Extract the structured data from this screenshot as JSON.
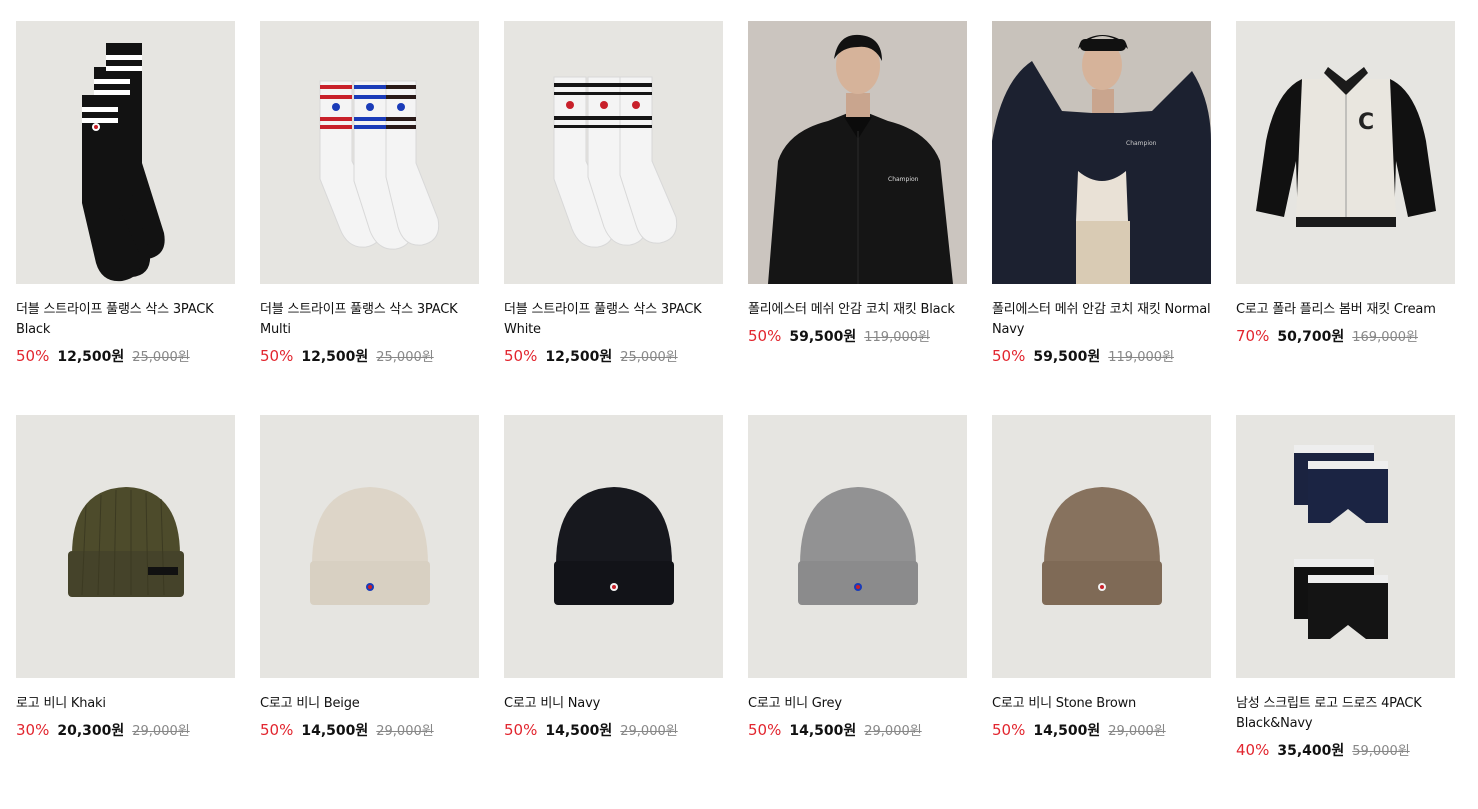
{
  "products": [
    {
      "name": "더블 스트라이프 풀랭스 삭스 3PACK Black",
      "discount": "50%",
      "price": "12,500원",
      "original": "25,000원",
      "image": "black-socks-3pack",
      "stripe_color": "#111111"
    },
    {
      "name": "더블 스트라이프 풀랭스 삭스 3PACK Multi",
      "discount": "50%",
      "price": "12,500원",
      "original": "25,000원",
      "image": "multi-socks-3pack"
    },
    {
      "name": "더블 스트라이프 풀랭스 삭스 3PACK White",
      "discount": "50%",
      "price": "12,500원",
      "original": "25,000원",
      "image": "white-socks-3pack"
    },
    {
      "name": "폴리에스터 메쉬 안감 코치 재킷 Black",
      "discount": "50%",
      "price": "59,500원",
      "original": "119,000원",
      "image": "black-coach-jacket-male-model"
    },
    {
      "name": "폴리에스터 메쉬 안감 코치 재킷 Normal Navy",
      "discount": "50%",
      "price": "59,500원",
      "original": "119,000원",
      "image": "navy-coach-jacket-female-model"
    },
    {
      "name": "C로고 폴라 플리스 봄버 재킷 Cream",
      "discount": "70%",
      "price": "50,700원",
      "original": "169,000원",
      "image": "cream-fleece-bomber"
    },
    {
      "name": "로고 비니 Khaki",
      "discount": "30%",
      "price": "20,300원",
      "original": "29,000원",
      "image": "khaki-beanie",
      "color": "#4b4a2a"
    },
    {
      "name": "C로고 비니 Beige",
      "discount": "50%",
      "price": "14,500원",
      "original": "29,000원",
      "image": "beige-beanie",
      "color": "#ddd5c8"
    },
    {
      "name": "C로고 비니 Navy",
      "discount": "50%",
      "price": "14,500원",
      "original": "29,000원",
      "image": "navy-beanie",
      "color": "#15161c"
    },
    {
      "name": "C로고 비니 Grey",
      "discount": "50%",
      "price": "14,500원",
      "original": "29,000원",
      "image": "grey-beanie",
      "color": "#8f8f90"
    },
    {
      "name": "C로고 비니 Stone Brown",
      "discount": "50%",
      "price": "14,500원",
      "original": "29,000원",
      "image": "stone-brown-beanie",
      "color": "#85705c"
    },
    {
      "name": "남성 스크립트 로고 드로즈 4PACK Black&Navy",
      "discount": "40%",
      "price": "35,400원",
      "original": "59,000원",
      "image": "drawers-4pack"
    }
  ]
}
